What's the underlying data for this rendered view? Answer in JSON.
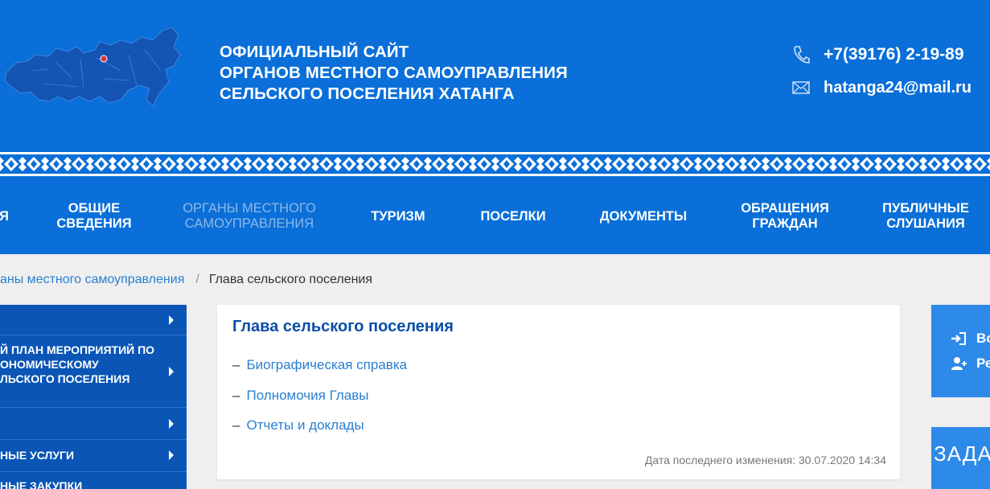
{
  "header": {
    "title_lines": [
      "ОФИЦИАЛЬНЫЙ САЙТ",
      "ОРГАНОВ МЕСТНОГО САМОУПРАВЛЕНИЯ",
      "СЕЛЬСКОГО ПОСЕЛЕНИЯ ХАТАНГА"
    ],
    "phone": "+7(39176) 2-19-89",
    "email": "hatanga24@mail.ru",
    "phone_icon": "phone-icon",
    "email_icon": "envelope-icon"
  },
  "nav": {
    "items": [
      {
        "label_lines": [
          "Я"
        ]
      },
      {
        "label_lines": [
          "ОБЩИЕ",
          "СВЕДЕНИЯ"
        ]
      },
      {
        "label_lines": [
          "ОРГАНЫ МЕСТНОГО",
          "САМОУПРАВЛЕНИЯ"
        ],
        "active": true
      },
      {
        "label_lines": [
          "ТУРИЗМ"
        ]
      },
      {
        "label_lines": [
          "ПОСЕЛКИ"
        ]
      },
      {
        "label_lines": [
          "ДОКУМЕНТЫ"
        ]
      },
      {
        "label_lines": [
          "ОБРАЩЕНИЯ",
          "ГРАЖДАН"
        ]
      },
      {
        "label_lines": [
          "ПУБЛИЧНЫЕ",
          "СЛУШАНИЯ"
        ]
      }
    ]
  },
  "breadcrumb": {
    "parent": "аны местного самоуправления",
    "separator": "/",
    "current": "Глава сельского поселения"
  },
  "sidebar": {
    "items": [
      {
        "label_lines": [
          ""
        ]
      },
      {
        "label_lines": [
          "Й ПЛАН МЕРОПРИЯТИЙ ПО",
          "ОНОМИЧЕСКОМУ",
          "ЛЬСКОГО ПОСЕЛЕНИЯ"
        ]
      },
      {
        "label_lines": [
          ""
        ]
      },
      {
        "label_lines": [
          "НЫЕ УСЛУГИ"
        ]
      },
      {
        "label_lines": [
          "НЫЕ ЗАКУПКИ"
        ]
      }
    ]
  },
  "content": {
    "title": "Глава сельского поселения",
    "links": [
      "Биографическая справка",
      "Полномочия Главы",
      "Отчеты и доклады"
    ],
    "link_prefix": "–",
    "last_modified": "Дата последнего изменения: 30.07.2020 14:34"
  },
  "login": {
    "login_label": "Во",
    "register_label": "Ре"
  },
  "ask": {
    "label": "ЗАДА"
  },
  "colors": {
    "header_blue": "#0a6fd8",
    "sidebar_blue": "#0a55b5",
    "widget_blue": "#2d8ae8",
    "link_blue": "#2a7fd0",
    "title_blue": "#0a4ea8"
  }
}
